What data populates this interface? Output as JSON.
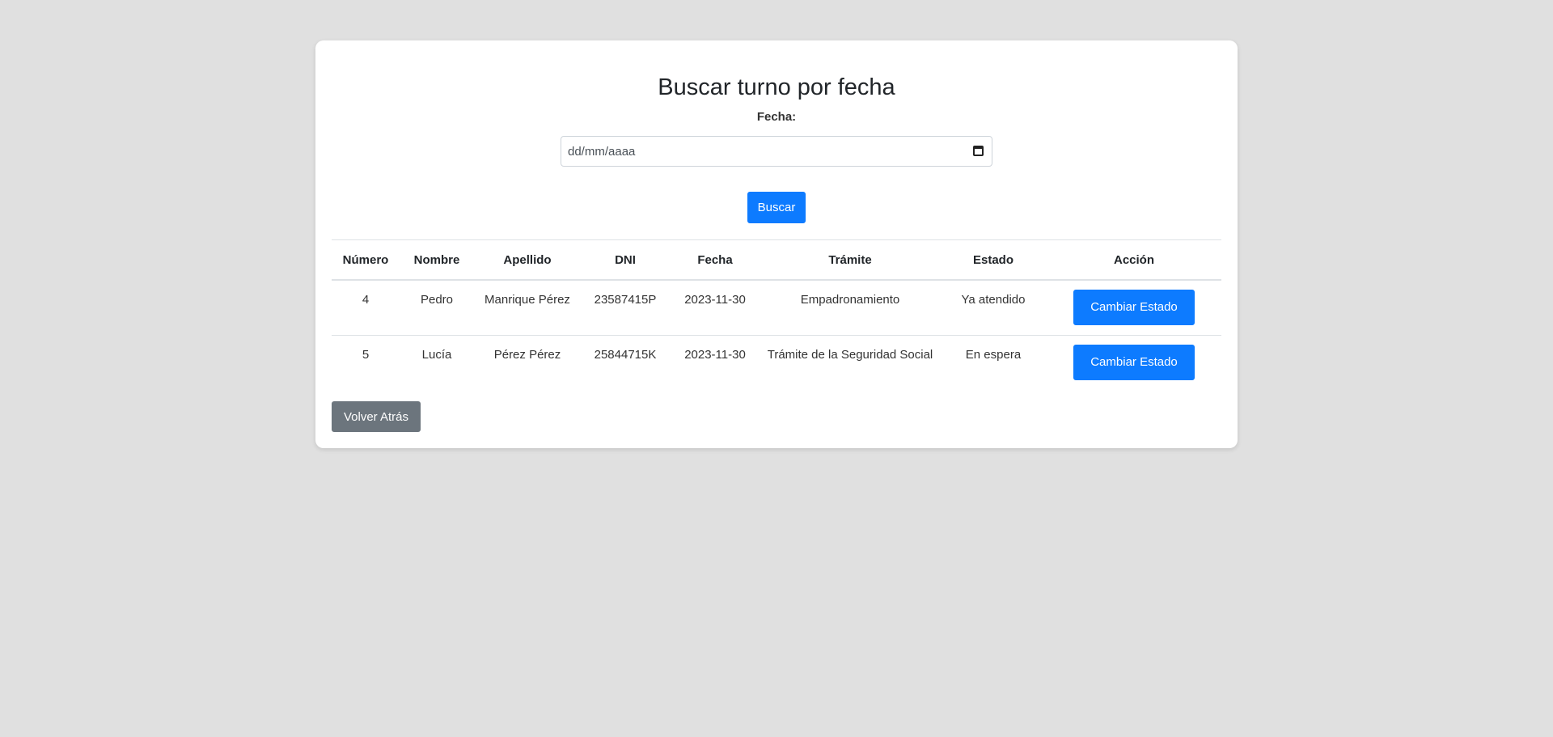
{
  "page": {
    "title": "Buscar turno por fecha",
    "date_label": "Fecha:",
    "date_placeholder": "dd/mm/aaaa",
    "search_button": "Buscar",
    "back_button": "Volver Atrás"
  },
  "table": {
    "headers": {
      "numero": "Número",
      "nombre": "Nombre",
      "apellido": "Apellido",
      "dni": "DNI",
      "fecha": "Fecha",
      "tramite": "Trámite",
      "estado": "Estado",
      "accion": "Acción"
    },
    "rows": [
      {
        "numero": "4",
        "nombre": "Pedro",
        "apellido": "Manrique Pérez",
        "dni": "23587415P",
        "fecha": "2023-11-30",
        "tramite": "Empadronamiento",
        "estado": "Ya atendido",
        "accion": "Cambiar Estado"
      },
      {
        "numero": "5",
        "nombre": "Lucía",
        "apellido": "Pérez Pérez",
        "dni": "25844715K",
        "fecha": "2023-11-30",
        "tramite": "Trámite de la Seguridad Social",
        "estado": "En espera",
        "accion": "Cambiar Estado"
      }
    ]
  },
  "colors": {
    "background": "#e0e0e0",
    "primary": "#0d7bff",
    "secondary": "#6c757d"
  },
  "icons": {
    "date_picker": "calendar-icon"
  }
}
